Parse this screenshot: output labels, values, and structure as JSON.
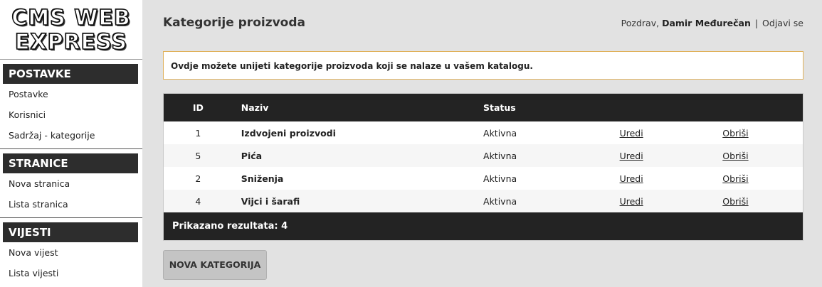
{
  "logo": {
    "line1": "CMS WEB",
    "line2": "EXPRESS"
  },
  "sidebar": {
    "sections": [
      {
        "title": "POSTAVKE",
        "items": [
          "Postavke",
          "Korisnici",
          "Sadržaj - kategorije"
        ]
      },
      {
        "title": "STRANICE",
        "items": [
          "Nova stranica",
          "Lista stranica"
        ]
      },
      {
        "title": "VIJESTI",
        "items": [
          "Nova vijest",
          "Lista vijesti"
        ]
      }
    ]
  },
  "header": {
    "title": "Kategorije proizvoda",
    "greeting": "Pozdrav,",
    "user_name": "Damir Međurečan",
    "separator": "|",
    "logout": "Odjavi se"
  },
  "info": {
    "text": "Ovdje možete unijeti kategorije proizvoda koji se nalaze u vašem katalogu."
  },
  "table": {
    "headers": {
      "id": "ID",
      "name": "Naziv",
      "status": "Status"
    },
    "rows": [
      {
        "id": "1",
        "name": "Izdvojeni proizvodi",
        "status": "Aktivna",
        "edit": "Uredi",
        "delete": "Obriši"
      },
      {
        "id": "5",
        "name": "Pića",
        "status": "Aktivna",
        "edit": "Uredi",
        "delete": "Obriši"
      },
      {
        "id": "2",
        "name": "Sniženja",
        "status": "Aktivna",
        "edit": "Uredi",
        "delete": "Obriši"
      },
      {
        "id": "4",
        "name": "Vijci i šarafi",
        "status": "Aktivna",
        "edit": "Uredi",
        "delete": "Obriši"
      }
    ],
    "footer": "Prikazano rezultata: 4"
  },
  "actions": {
    "new_category": "NOVA KATEGORIJA"
  },
  "colors": {
    "dark": "#232323",
    "info_border": "#e0b15a",
    "background": "#e2e2e2",
    "button": "#c4c4c4"
  }
}
